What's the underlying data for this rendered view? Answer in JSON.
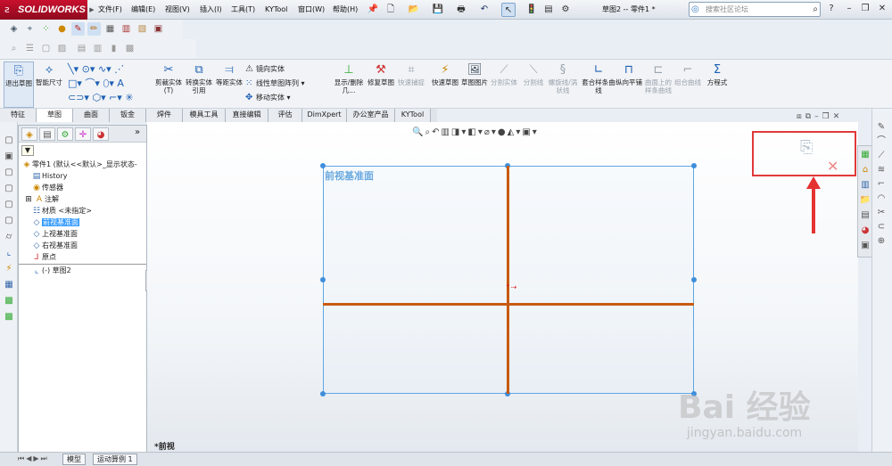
{
  "app": {
    "logo": "SOLIDWORKS",
    "document_title": "草图2 -- 零件1 *"
  },
  "menu": [
    "文件(F)",
    "编辑(E)",
    "视图(V)",
    "插入(I)",
    "工具(T)",
    "KYTool",
    "窗口(W)",
    "帮助(H)"
  ],
  "search": {
    "placeholder": "搜索社区论坛"
  },
  "command_manager": {
    "exit_sketch": "退出草图",
    "smart_dimension": "智能尺寸",
    "trim": "剪裁实体(T)",
    "convert": "转换实体引用",
    "offset": "等距实体",
    "mirror": "镜向实体",
    "linear_pattern": "线性草图阵列",
    "move": "移动实体",
    "show_hide": "显示/删除几...",
    "repair": "修复草图",
    "quick_snaps": "快速捕捉",
    "rapid_sketch": "快速草图",
    "sketch_picture": "草图图片",
    "split_entities": "分割实体",
    "split_line": "分割线",
    "helix": "螺旋线/涡状线",
    "fit_spline": "套合样条曲线",
    "section": "纵向平铺",
    "surface_spline": "曲面上的样条曲线",
    "composite_curve": "组合曲线",
    "equation": "方程式"
  },
  "tabs": [
    "特征",
    "草图",
    "曲面",
    "钣金",
    "焊件",
    "模具工具",
    "直接编辑",
    "评估",
    "DimXpert",
    "办公室产品",
    "KYTool"
  ],
  "active_tab": "草图",
  "feature_tree": {
    "root": "零件1 (默认<<默认>_显示状态-",
    "items": [
      "History",
      "传感器",
      "注解",
      "材质 <未指定>",
      "前视基准面",
      "上视基准面",
      "右视基准面",
      "原点",
      "(-) 草图2"
    ]
  },
  "graphics": {
    "plane_label": "前视基准面",
    "view_name": "*前视"
  },
  "bottom_tabs": [
    "模型",
    "运动算例 1"
  ],
  "watermark": {
    "brand": "Bai 经验",
    "url": "jingyan.baidu.com"
  },
  "colors": {
    "accent": "#c8102e",
    "selection": "#3399ff",
    "sketch_line": "#c85a10",
    "callout": "#e03a3a"
  }
}
